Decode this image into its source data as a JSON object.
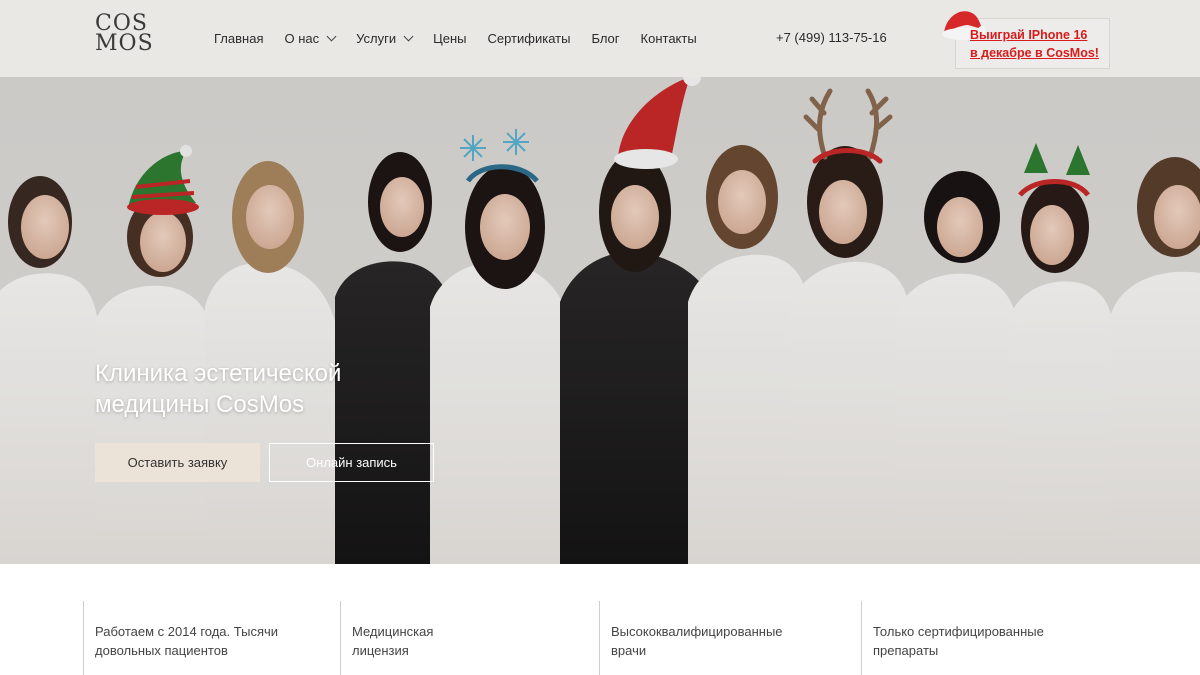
{
  "brand": {
    "logo_line1": "COS",
    "logo_line2": "MOS"
  },
  "nav": {
    "items": [
      {
        "label": "Главная",
        "has_dropdown": false
      },
      {
        "label": "О нас",
        "has_dropdown": true
      },
      {
        "label": "Услуги",
        "has_dropdown": true
      },
      {
        "label": "Цены",
        "has_dropdown": false
      },
      {
        "label": "Сертификаты",
        "has_dropdown": false
      },
      {
        "label": "Блог",
        "has_dropdown": false
      },
      {
        "label": "Контакты",
        "has_dropdown": false
      }
    ]
  },
  "header": {
    "phone": "+7 (499) 113-75-16",
    "promo": "Выиграй IPhone 16 \nв декабре в CosMos!",
    "promo_color": "#d81c1c"
  },
  "hero": {
    "title": "Клиника эстетической медицины CosMos",
    "primary_button": "Оставить заявку",
    "secondary_button": "Онлайн запись"
  },
  "features": [
    "Работаем с 2014 года. Тысячи\nдовольных пациентов",
    "Медицинская\nлицензия",
    "Высококвалифицированные\nврачи",
    "Только сертифицированные\nпрепараты"
  ],
  "colors": {
    "header_bg": "#e9e8e5",
    "button_bg": "#ece3d8",
    "accent_red": "#d81c1c"
  }
}
